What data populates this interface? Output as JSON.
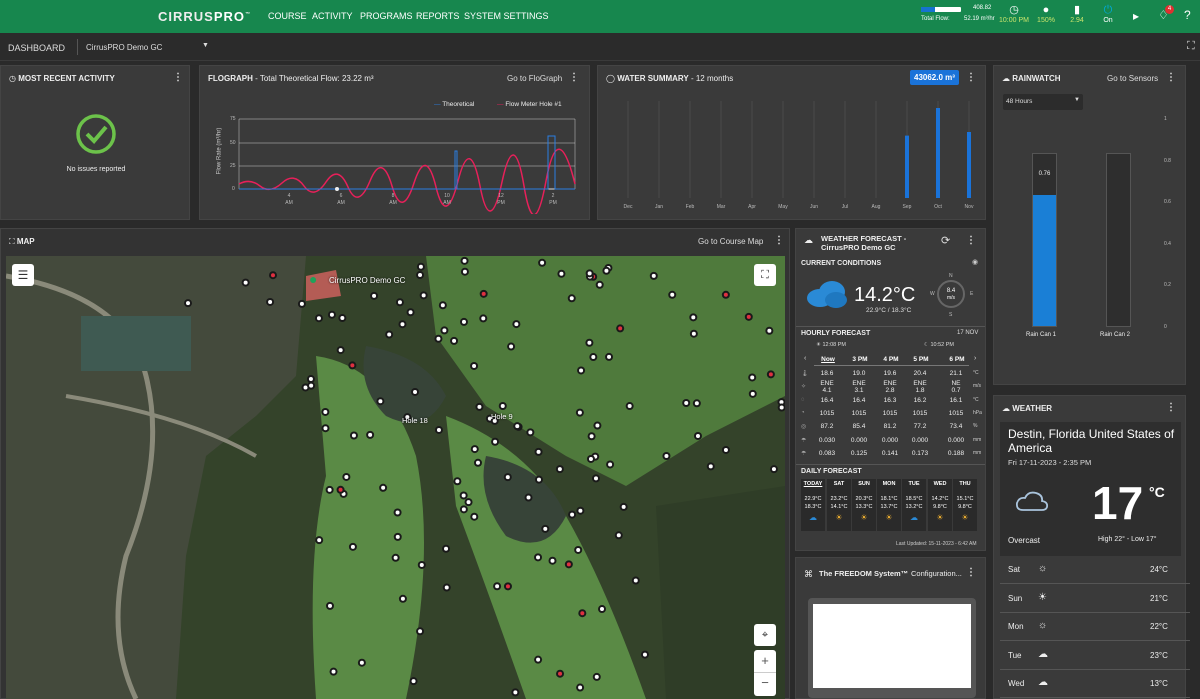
{
  "app": {
    "logo_a": "CIRRUS",
    "logo_b": "PRO"
  },
  "nav": [
    {
      "label": "COURSE"
    },
    {
      "label": "ACTIVITY"
    },
    {
      "label": "PROGRAMS"
    },
    {
      "label": "REPORTS"
    },
    {
      "label": "SYSTEM SETTINGS"
    }
  ],
  "flow": {
    "max": "408.82",
    "label": "Total Flow:",
    "value": "52.19 m³/hr",
    "fill_pct": 35
  },
  "status": [
    {
      "icon": "◷",
      "value": "10:00 PM",
      "name": "clock-icon"
    },
    {
      "icon": "💧",
      "value": "150%",
      "name": "water-drop-icon"
    },
    {
      "icon": "▮",
      "value": "2.94",
      "name": "battery-icon"
    },
    {
      "icon": "⏻",
      "value": "On",
      "name": "power-icon"
    }
  ],
  "notif_count": "4",
  "sub": {
    "dashboard": "DASHBOARD",
    "course": "CirrusPRO Demo GC"
  },
  "activity": {
    "title": "MOST RECENT ACTIVITY",
    "msg": "No issues reported"
  },
  "flograph": {
    "title": "FLOGRAPH",
    "subtitle": " - Total Theoretical Flow: 23.22 m³",
    "link": "Go to FloGraph",
    "legend_a": "Theoretical",
    "legend_b": "Flow Meter Hole #1",
    "ylabel": "Flow Rate (m³/hr)",
    "yticks": [
      "75",
      "50",
      "25",
      "0"
    ],
    "xticks": [
      {
        "h": "4",
        "p": "AM"
      },
      {
        "h": "6",
        "p": "AM"
      },
      {
        "h": "8",
        "p": "AM"
      },
      {
        "h": "10",
        "p": "AM"
      },
      {
        "h": "12",
        "p": "PM"
      },
      {
        "h": "2",
        "p": "PM"
      }
    ]
  },
  "water": {
    "title": "WATER SUMMARY",
    "subtitle": " - 12 months",
    "total": "43062.0 m³",
    "months": [
      "Dec",
      "Jan",
      "Feb",
      "Mar",
      "Apr",
      "May",
      "Jun",
      "Jul",
      "Aug",
      "Sep",
      "Oct",
      "Nov"
    ]
  },
  "rain": {
    "title": "RAINWATCH",
    "link": "Go to Sensors",
    "range": "48 Hours",
    "yticks": [
      "1",
      "0.8",
      "0.6",
      "0.4",
      "0.2",
      "0"
    ],
    "can1": "Rain Can 1",
    "can2": "Rain Can 2",
    "can1_val": "0.76"
  },
  "map": {
    "title": "MAP",
    "link": "Go to Course Map",
    "course_label": "CirrusPRO Demo GC",
    "hole18": "Hole 18",
    "hole9": "Hole 9"
  },
  "forecast": {
    "title": "WEATHER FORECAST -",
    "title2": "CirrusPRO Demo GC",
    "current": "CURRENT CONDITIONS",
    "temp": "14.2°C",
    "hilo": "22.9°C / 18.3°C",
    "wind_val": "8.4",
    "wind_unit": "m/s",
    "hourly": "HOURLY FORECAST",
    "date": "17 NOV",
    "sunrise": "12:08 PM",
    "sunset": "10:52 PM",
    "hours": [
      "Now",
      "3 PM",
      "4 PM",
      "5 PM",
      "6 PM"
    ],
    "rows": [
      [
        "18.6",
        "19.0",
        "19.6",
        "20.4",
        "21.1",
        "°C"
      ],
      [
        "ENE 4.1",
        "ENE 3.1",
        "ENE 2.8",
        "ENE 1.8",
        "NE 0.7",
        "m/s"
      ],
      [
        "16.4",
        "16.4",
        "16.3",
        "16.2",
        "16.1",
        "°C"
      ],
      [
        "1015",
        "1015",
        "1015",
        "1015",
        "1015",
        "hPa"
      ],
      [
        "87.2",
        "85.4",
        "81.2",
        "77.2",
        "73.4",
        "%"
      ],
      [
        "0.030",
        "0.000",
        "0.000",
        "0.000",
        "0.000",
        "mm"
      ],
      [
        "0.083",
        "0.125",
        "0.141",
        "0.173",
        "0.188",
        "mm"
      ]
    ],
    "daily": "DAILY FORECAST",
    "days": [
      {
        "d": "TODAY",
        "hi": "22.9°C",
        "lo": "18.3°C"
      },
      {
        "d": "SAT",
        "hi": "23.2°C",
        "lo": "14.1°C"
      },
      {
        "d": "SUN",
        "hi": "20.3°C",
        "lo": "13.3°C"
      },
      {
        "d": "MON",
        "hi": "18.1°C",
        "lo": "13.7°C"
      },
      {
        "d": "TUE",
        "hi": "18.5°C",
        "lo": "13.2°C"
      },
      {
        "d": "WED",
        "hi": "14.2°C",
        "lo": "9.8°C"
      },
      {
        "d": "THU",
        "hi": "15.1°C",
        "lo": "9.8°C"
      }
    ],
    "updated": "Last Updated: 15-11-2023 - 6:42 AM"
  },
  "freedom": {
    "title": "The FREEDOM System™",
    "link": "Configuration..."
  },
  "weather": {
    "title": "WEATHER",
    "city": "Destin, Florida United States of America",
    "date": "Fri 17-11-2023 - 2:35 PM",
    "temp": "17",
    "unit": "°C",
    "cond": "Overcast",
    "hilo": "High 22° - Low 17°",
    "days": [
      {
        "d": "Sat",
        "t": "24°C",
        "i": "☼"
      },
      {
        "d": "Sun",
        "t": "21°C",
        "i": "☀"
      },
      {
        "d": "Mon",
        "t": "22°C",
        "i": "☼"
      },
      {
        "d": "Tue",
        "t": "23°C",
        "i": "☁"
      },
      {
        "d": "Wed",
        "t": "13°C",
        "i": "☁"
      }
    ]
  }
}
